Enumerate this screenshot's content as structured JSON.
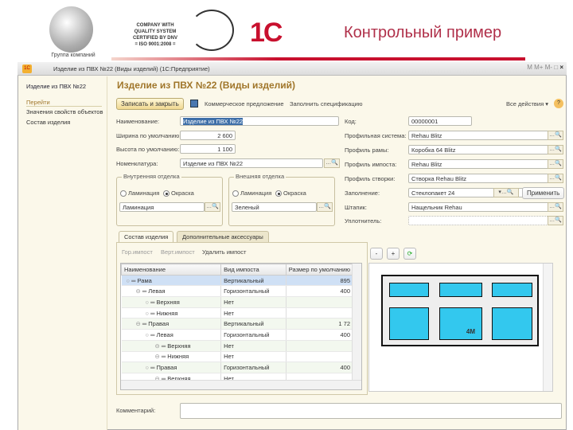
{
  "banner": {
    "group_label": "Группа компаний",
    "dnv_text": [
      "COMPANY WITH",
      "QUALITY SYSTEM",
      "CERTIFIED BY DNV",
      "= ISO 9001:2008 ="
    ],
    "logo_1c": "1С",
    "slide_title": "Контрольный пример"
  },
  "window": {
    "title": "Изделие из ПВХ №22 (Виды изделий) (1С:Предприятие)",
    "buttons": [
      "M",
      "M+",
      "M-",
      "□",
      "×"
    ]
  },
  "sidebar": {
    "current": "Изделие из ПВХ №22",
    "section": "Перейти",
    "items": [
      "Значения свойств объектов",
      "Состав изделия"
    ]
  },
  "form": {
    "heading": "Изделие из ПВХ №22 (Виды изделий)",
    "toolbar": {
      "save_close": "Записать и закрыть",
      "commercial": "Коммерческое предложение",
      "fill_spec": "Заполнить спецификацию",
      "all_actions": "Все действия ▾",
      "help": "?"
    },
    "left_fields": [
      {
        "label": "Наименование:",
        "value": "Изделие из ПВХ №22"
      },
      {
        "label": "Ширина по умолчанию:",
        "value": "2 600"
      },
      {
        "label": "Высота по умолчанию:",
        "value": "1 100"
      },
      {
        "label": "Номенклатура:",
        "value": "Изделие из ПВХ №22"
      }
    ],
    "inner": {
      "title": "Внутренняя отделка",
      "opt1": "Ламинация",
      "opt2": "Окраска",
      "value": "Ламинация"
    },
    "outer": {
      "title": "Внешняя отделка",
      "opt1": "Ламинация",
      "opt2": "Окраска",
      "value": "Зеленый"
    },
    "right_fields": [
      {
        "label": "Код:",
        "value": "00000001"
      },
      {
        "label": "Профильная система:",
        "value": "Rehau Blitz"
      },
      {
        "label": "Профиль рамы:",
        "value": "Коробка 64 Blitz"
      },
      {
        "label": "Профиль импоста:",
        "value": "Rehau Blitz"
      },
      {
        "label": "Профиль створки:",
        "value": "Створка Rehau Blitz"
      },
      {
        "label": "Заполнение:",
        "value": "Стеклопакет 24"
      },
      {
        "label": "Штапик:",
        "value": "Нащельник Rehau"
      },
      {
        "label": "Уплотнитель:",
        "value": ""
      }
    ],
    "apply": "Применить",
    "tabs": [
      "Состав изделия",
      "Дополнительные аксессуары"
    ],
    "table_toolbar": [
      "Гор.импост",
      "Верт.импост",
      "Удалить импост"
    ],
    "columns": [
      "Наименование",
      "Вид импоста",
      "Размер по умолчанию"
    ],
    "rows": [
      {
        "name": "Рама",
        "type": "Вертикальный",
        "size": "895",
        "level": 0
      },
      {
        "name": "Левая",
        "type": "Горизонтальный",
        "size": "400",
        "level": 1
      },
      {
        "name": "Верхняя",
        "type": "Нет",
        "size": "",
        "level": 2
      },
      {
        "name": "Нижняя",
        "type": "Нет",
        "size": "",
        "level": 2
      },
      {
        "name": "Правая",
        "type": "Вертикальный",
        "size": "1 72",
        "level": 1
      },
      {
        "name": "Левая",
        "type": "Горизонтальный",
        "size": "400",
        "level": 2
      },
      {
        "name": "Верхняя",
        "type": "Нет",
        "size": "",
        "level": 3
      },
      {
        "name": "Нижняя",
        "type": "Нет",
        "size": "",
        "level": 3
      },
      {
        "name": "Правая",
        "type": "Горизонтальный",
        "size": "400",
        "level": 2
      },
      {
        "name": "Верхняя",
        "type": "Нет",
        "size": "",
        "level": 3
      }
    ],
    "zoom_buttons": [
      "-",
      "+",
      "⟳"
    ],
    "drawing_label": "4M",
    "comment_label": "Комментарий:",
    "comment_value": ""
  }
}
